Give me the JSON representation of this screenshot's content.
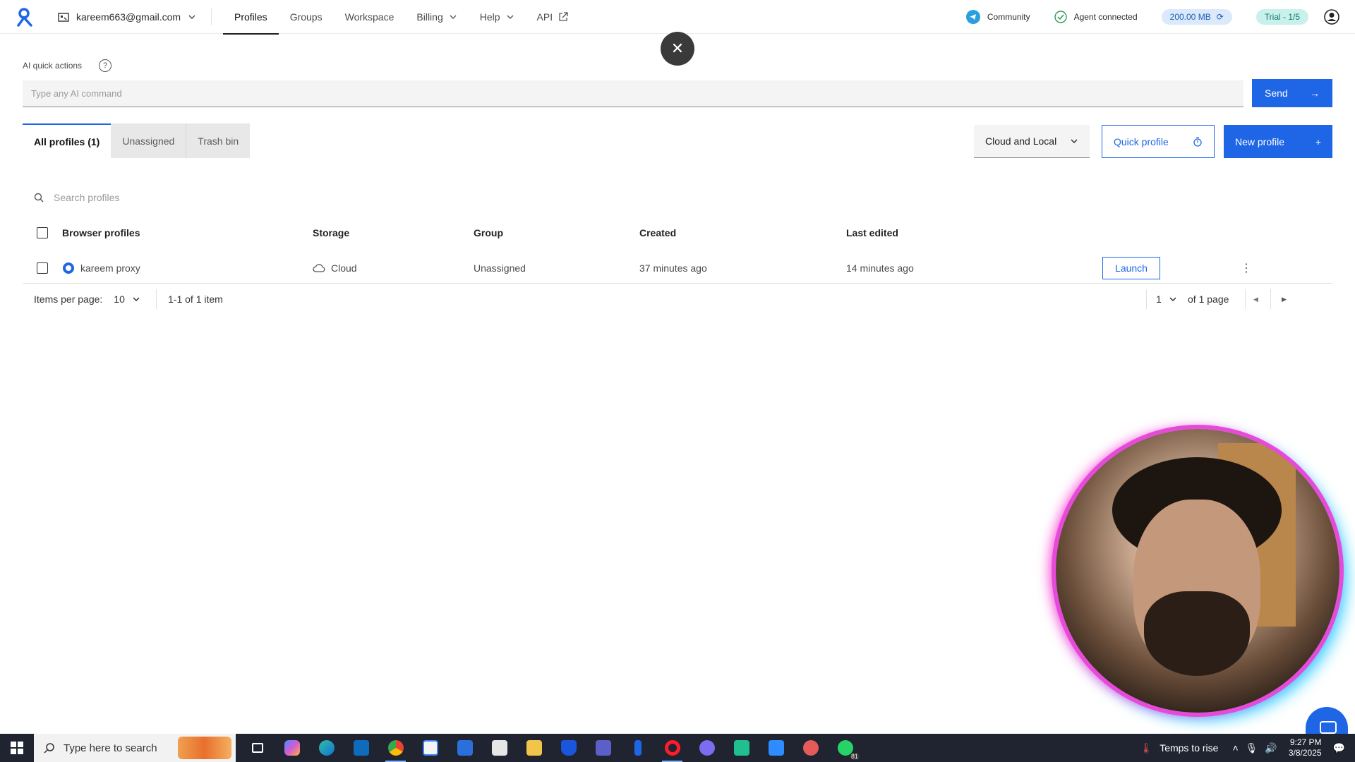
{
  "header": {
    "account_email": "kareem663@gmail.com",
    "nav": [
      {
        "label": "Profiles",
        "active": true,
        "has_chevron": false
      },
      {
        "label": "Groups",
        "active": false,
        "has_chevron": false
      },
      {
        "label": "Workspace",
        "active": false,
        "has_chevron": false
      },
      {
        "label": "Billing",
        "active": false,
        "has_chevron": true
      },
      {
        "label": "Help",
        "active": false,
        "has_chevron": true
      },
      {
        "label": "API",
        "active": false,
        "has_chevron": false
      }
    ],
    "community_label": "Community",
    "agent_label": "Agent connected",
    "storage_label": "200.00 MB",
    "trial_label": "Trial - 1/5"
  },
  "ai": {
    "label": "AI quick actions",
    "placeholder": "Type any AI command",
    "send_label": "Send"
  },
  "tabs": [
    "All profiles (1)",
    "Unassigned",
    "Trash bin"
  ],
  "toolbar": {
    "filter_value": "Cloud and Local",
    "quick_label": "Quick profile",
    "new_label": "New profile"
  },
  "search": {
    "placeholder": "Search profiles"
  },
  "table": {
    "headers": [
      "Browser profiles",
      "Storage",
      "Group",
      "Created",
      "Last edited"
    ],
    "rows": [
      {
        "name": "kareem proxy",
        "storage": "Cloud",
        "group": "Unassigned",
        "created": "37 minutes ago",
        "edited": "14 minutes ago",
        "action": "Launch"
      }
    ]
  },
  "pagination": {
    "items_per_page_label": "Items per page:",
    "items_per_page": "10",
    "range": "1-1 of 1 item",
    "page": "1",
    "of_pages": "of 1 page"
  },
  "taskbar": {
    "search_placeholder": "Type here to search",
    "weather": "Temps to rise",
    "time": "9:27 PM",
    "date": "3/8/2025",
    "whatsapp_badge": "81"
  },
  "colors": {
    "accent": "#1e66e6",
    "trial": "#c8f1ec",
    "storage": "#dbe9fb"
  }
}
